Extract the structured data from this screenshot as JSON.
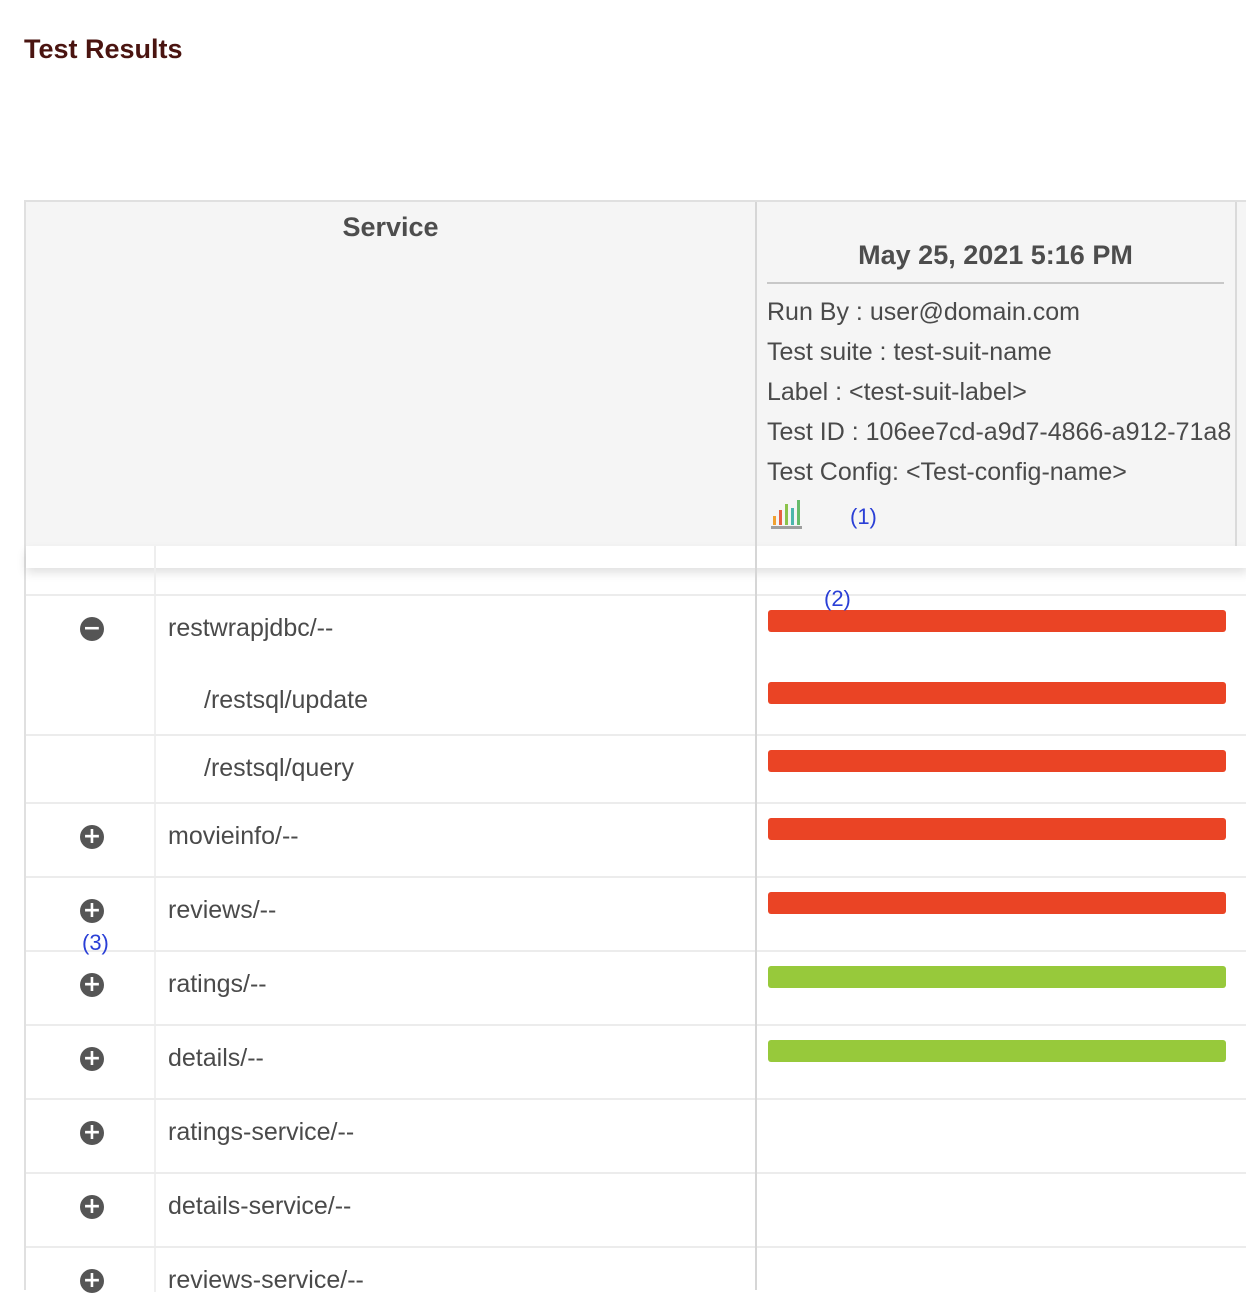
{
  "page": {
    "title": "Test Results"
  },
  "table": {
    "service_header": "Service",
    "run": {
      "date": "May 25, 2021 5:16 PM",
      "meta": [
        "Run By : user@domain.com",
        "Test suite : test-suit-name",
        "Label : <test-suit-label>",
        "Test ID : 106ee7cd-a9d7-4866-a912-71a8",
        "Test Config: <Test-config-name>"
      ],
      "chart_icon": "bar-chart-icon"
    },
    "rows": [
      {
        "icon": "collapse-minus-icon",
        "label": "restwrapjdbc/--",
        "status": "fail"
      },
      {
        "icon": "",
        "label": "/restsql/update",
        "status": "fail"
      },
      {
        "icon": "",
        "label": "/restsql/query",
        "status": "fail"
      },
      {
        "icon": "expand-plus-icon",
        "label": "movieinfo/--",
        "status": "fail"
      },
      {
        "icon": "expand-plus-icon",
        "label": "reviews/--",
        "status": "fail"
      },
      {
        "icon": "expand-plus-icon",
        "label": "ratings/--",
        "status": "pass"
      },
      {
        "icon": "expand-plus-icon",
        "label": "details/--",
        "status": "pass"
      },
      {
        "icon": "expand-plus-icon",
        "label": "ratings-service/--",
        "status": "none"
      },
      {
        "icon": "expand-plus-icon",
        "label": "details-service/--",
        "status": "none"
      },
      {
        "icon": "expand-plus-icon",
        "label": "reviews-service/--",
        "status": "none"
      }
    ]
  },
  "annotations": [
    "(1)",
    "(2)",
    "(3)"
  ],
  "colors": {
    "fail": "#ea4425",
    "pass": "#97c93b",
    "title": "#4a1410",
    "annotation": "#2a3fd6"
  }
}
